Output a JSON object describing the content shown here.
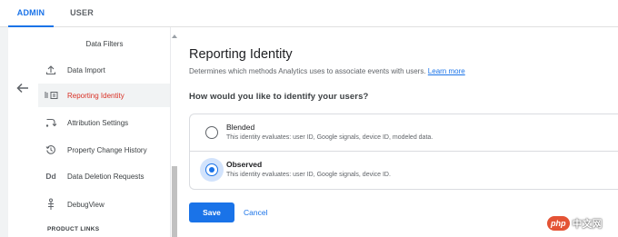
{
  "tabs": [
    {
      "label": "ADMIN",
      "active": true
    },
    {
      "label": "USER",
      "active": false
    }
  ],
  "nav": {
    "header": "Data Filters",
    "items": [
      {
        "label": "Data Import",
        "icon": "upload-icon",
        "active": false
      },
      {
        "label": "Reporting Identity",
        "icon": "reporting-identity-icon",
        "active": true
      },
      {
        "label": "Attribution Settings",
        "icon": "attribution-icon",
        "active": false
      },
      {
        "label": "Property Change History",
        "icon": "history-icon",
        "active": false
      },
      {
        "label": "Data Deletion Requests",
        "icon": "dd-icon",
        "active": false
      },
      {
        "label": "DebugView",
        "icon": "debug-icon",
        "active": false
      }
    ],
    "dd_glyph": "Dd",
    "section": "PRODUCT LINKS"
  },
  "main": {
    "title": "Reporting Identity",
    "description": "Determines which methods Analytics uses to associate events with users.",
    "learn_more": "Learn more",
    "question": "How would you like to identify your users?",
    "options": [
      {
        "label": "Blended",
        "sub": "This identity evaluates: user ID, Google signals, device ID, modeled data.",
        "selected": false
      },
      {
        "label": "Observed",
        "sub": "This identity evaluates: user ID, Google signals, device ID.",
        "selected": true
      }
    ],
    "save_label": "Save",
    "cancel_label": "Cancel"
  },
  "watermark": {
    "logo": "php",
    "text": "中文网"
  },
  "colors": {
    "accent": "#1a73e8",
    "active_nav_text": "#d93025",
    "watermark": "#e45335"
  }
}
